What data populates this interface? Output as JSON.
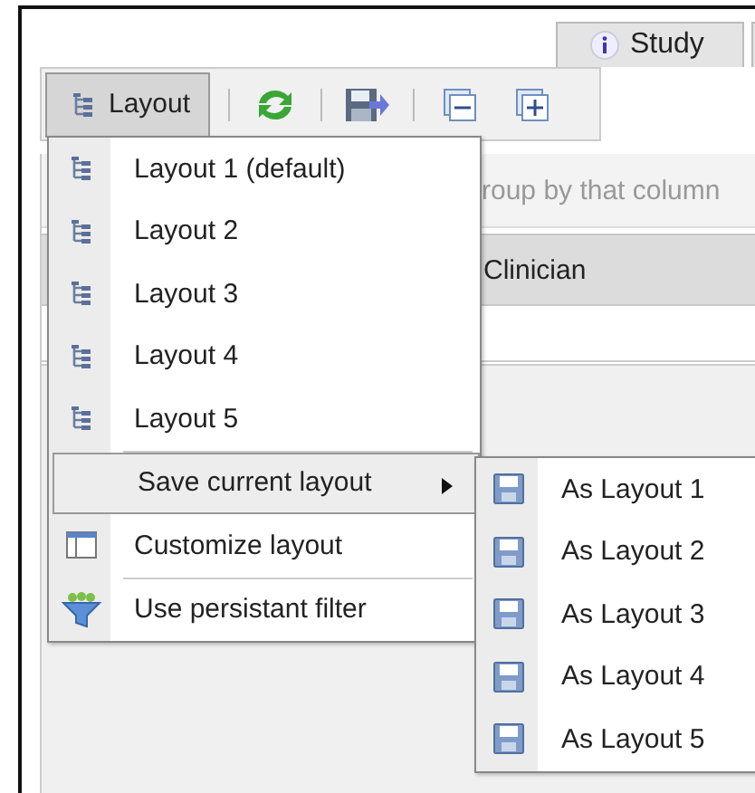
{
  "tabs": [
    {
      "label": "Study",
      "selected": true
    }
  ],
  "toolbar": {
    "layout_button": {
      "label": "Layout",
      "pressed": true
    }
  },
  "grid": {
    "group_hint": "roup by that column",
    "columns": [
      "Clinician"
    ]
  },
  "menu": {
    "items": [
      {
        "kind": "layout",
        "label": "Layout 1 (default)",
        "highlighted": false
      },
      {
        "kind": "layout",
        "label": "Layout 2",
        "highlighted": false
      },
      {
        "kind": "layout",
        "label": "Layout 3",
        "highlighted": false
      },
      {
        "kind": "layout",
        "label": "Layout 4",
        "highlighted": false
      },
      {
        "kind": "layout",
        "label": "Layout 5",
        "highlighted": false
      },
      {
        "kind": "separator"
      },
      {
        "kind": "submenu",
        "label": "Save current layout",
        "highlighted": true,
        "expanded": true
      },
      {
        "kind": "customize",
        "label": "Customize layout",
        "highlighted": false
      },
      {
        "kind": "separator"
      },
      {
        "kind": "filter",
        "label": "Use persistant filter",
        "highlighted": false
      }
    ]
  },
  "submenu": {
    "items": [
      {
        "label": "As Layout 1"
      },
      {
        "label": "As Layout 2"
      },
      {
        "label": "As Layout 3"
      },
      {
        "label": "As Layout 4"
      },
      {
        "label": "As Layout 5"
      }
    ]
  }
}
